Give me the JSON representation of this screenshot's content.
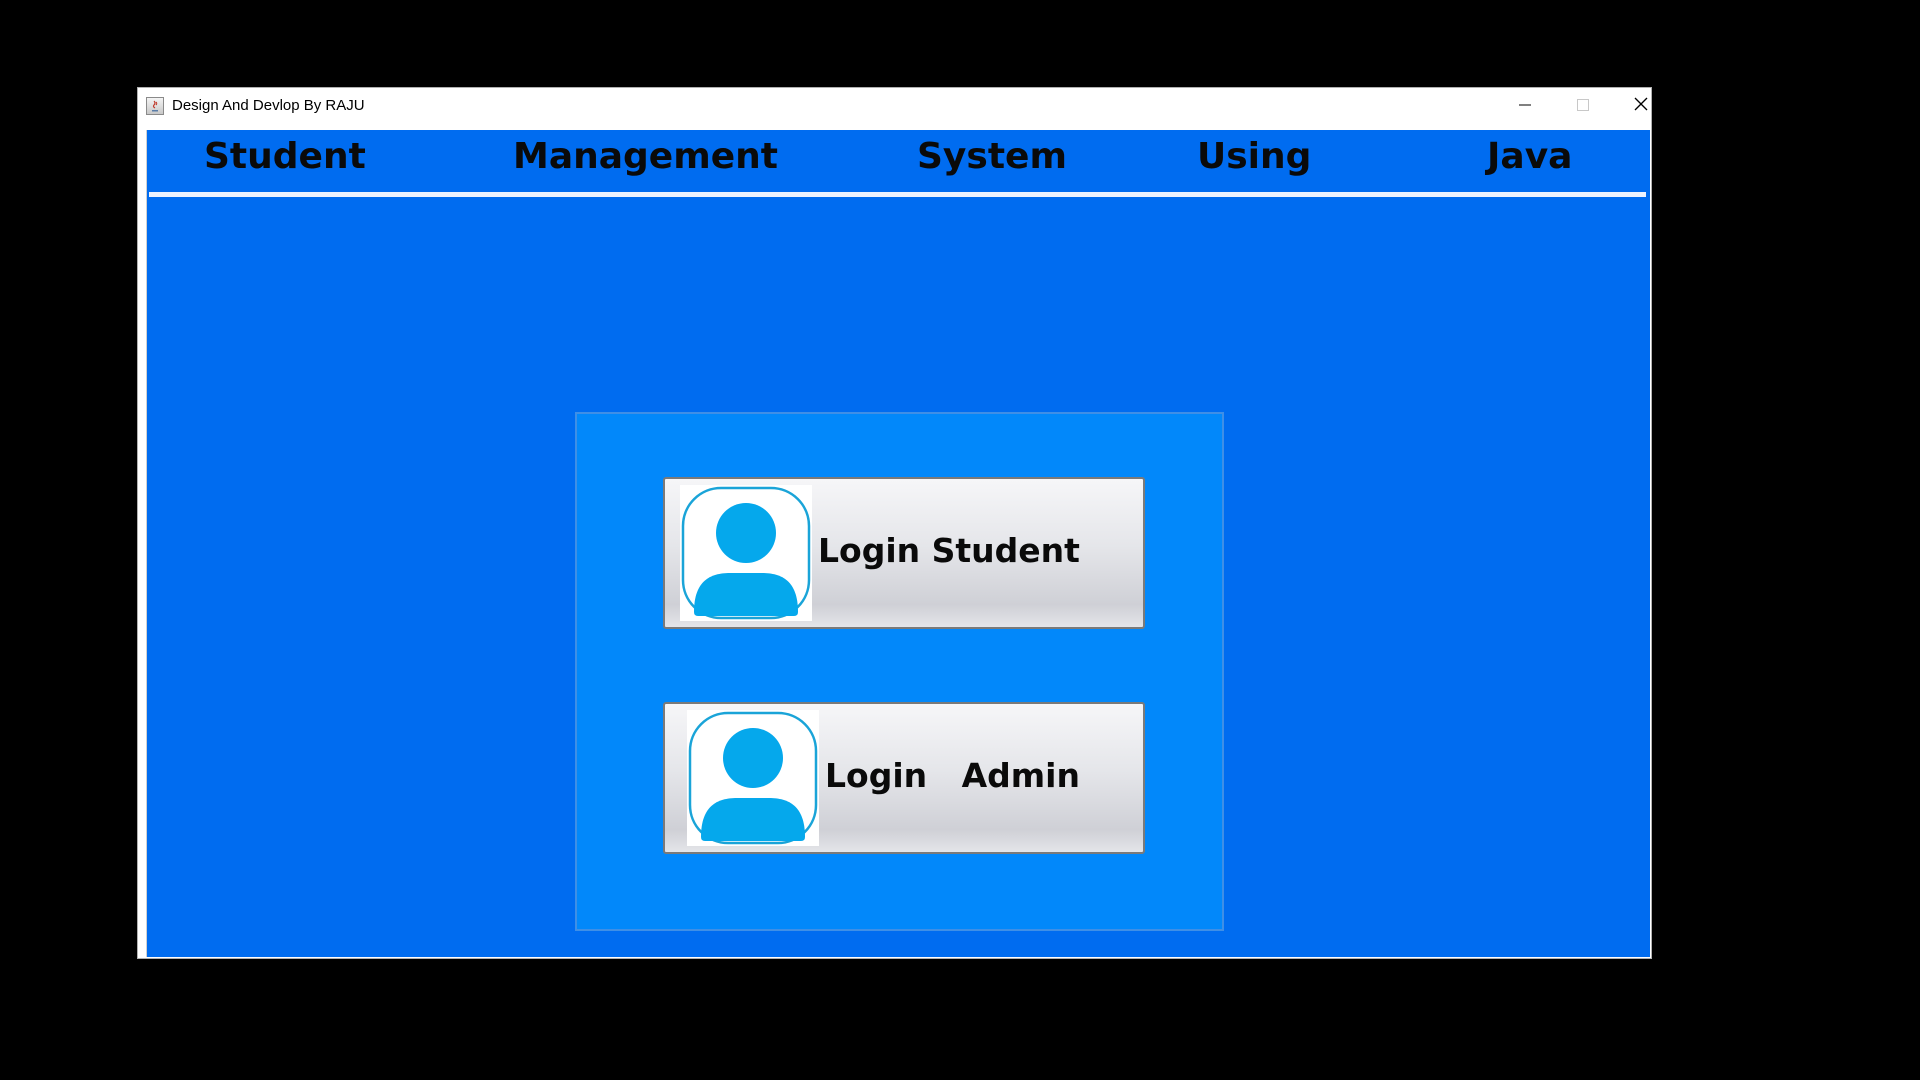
{
  "window": {
    "title": "Design And Devlop By RAJU",
    "icon": "java-app-icon",
    "controls": {
      "minimize": "minimize-icon",
      "maximize": "maximize-icon",
      "close": "close-icon"
    }
  },
  "header": {
    "words": [
      "Student",
      "Management",
      "System",
      "Using",
      "Java"
    ]
  },
  "login_panel": {
    "student_button": {
      "label": "Login Student",
      "icon": "user-avatar-icon"
    },
    "admin_button": {
      "label": "Login   Admin",
      "icon": "user-avatar-icon"
    }
  },
  "colors": {
    "background": "#006cf0",
    "panel": "#0288fa",
    "avatar": "#05a8ec"
  }
}
